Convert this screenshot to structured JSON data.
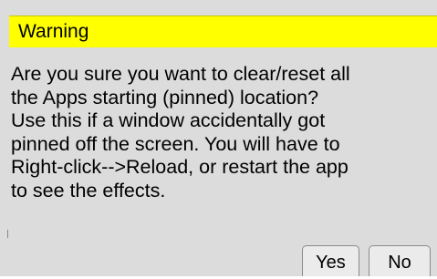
{
  "dialog": {
    "title": "Warning",
    "message_lines": [
      "Are you sure you want to clear/reset all",
      "the Apps starting (pinned) location?",
      "Use this if a window accidentally got",
      "pinned off the screen. You will have to",
      "Right-click-->Reload, or restart the app",
      "to see the effects."
    ],
    "buttons": {
      "yes_label": "Yes",
      "no_label": "No"
    }
  },
  "colors": {
    "title_bar": "#ffff00",
    "background": "#dcdcdc",
    "button_face": "#ebebeb"
  }
}
